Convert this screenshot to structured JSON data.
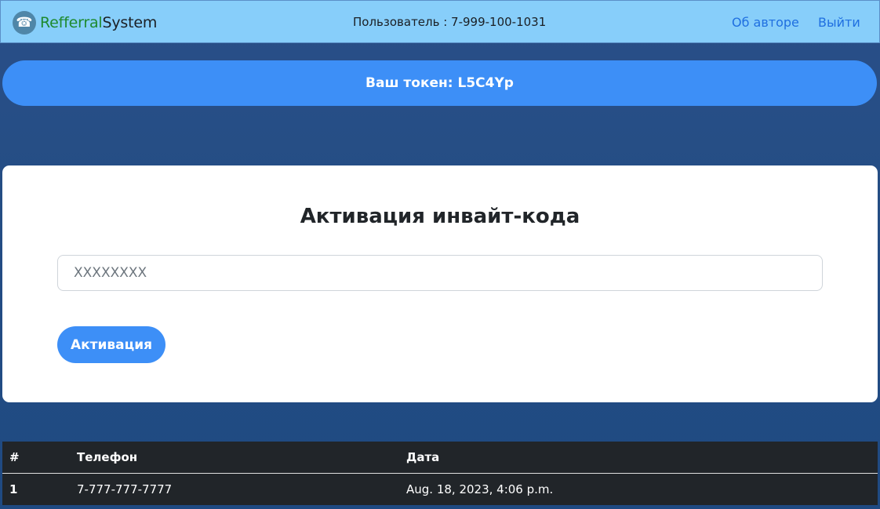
{
  "navbar": {
    "logo_icon": "phone-icon",
    "brand_part1": "Refferral",
    "brand_part2": "System",
    "user_label": "Пользователь : 7-999-100-1031",
    "links": [
      "Об авторе",
      "Выйти"
    ]
  },
  "token": {
    "text": "Ваш токен: L5C4Yp"
  },
  "activation": {
    "title": "Активация инвайт-кода",
    "placeholder": "XXXXXXXX",
    "button_label": "Активация"
  },
  "referrals": {
    "columns": [
      "#",
      "Телефон",
      "Дата"
    ],
    "rows": [
      [
        "1",
        "7-777-777-7777",
        "Aug. 18, 2023, 4:06 p.m."
      ]
    ]
  },
  "colors": {
    "navbar_bg": "#87cefa",
    "accent": "#3d8ff7",
    "page_bg": "#244d84",
    "table_bg": "#212529",
    "brand_green": "#1e8a2e",
    "link": "#1f6fe0"
  }
}
